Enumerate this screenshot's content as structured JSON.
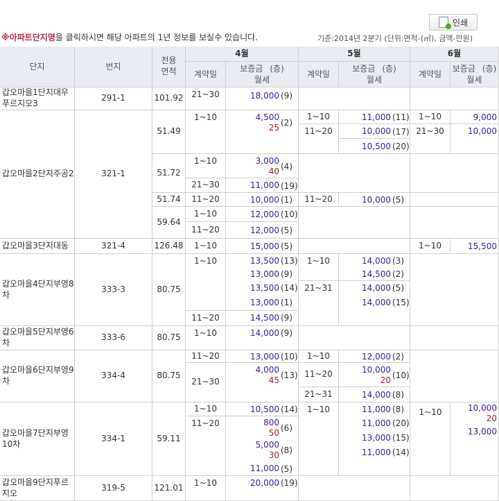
{
  "toolbar": {
    "print_label": "인쇄"
  },
  "notice": {
    "highlight": "※아파트단지명",
    "rest": "을 클릭하시면 해당 아파트의 1년 정보를 보실수 있습니다."
  },
  "basis": "기준:2014년 2분기    (단위:면적-(㎡), 금액-만원)",
  "headers": {
    "complex": "단지",
    "lot": "번지",
    "area_1": "전용",
    "area_2": "면적",
    "months": [
      "4월",
      "5월",
      "6월"
    ],
    "contract": "계약일",
    "deposit": "보증금",
    "rent": "월세",
    "floor": "(층)"
  },
  "rows": [
    {
      "name": "갑오마을1단지대우푸르지오3",
      "lot": "291-1",
      "area": "101.92",
      "m4_date": "21~30",
      "m4_dep": "18,000",
      "m4_floor": "(9)"
    },
    {
      "name": "갑오마을2단지주공2",
      "lot": "321-1"
    },
    {
      "name": "갑오마을3단지대동",
      "lot": "321-4",
      "area": "126.48",
      "m4_date": "1~10",
      "m4_dep": "15,000",
      "m4_floor": "(5)",
      "m6_date": "1~10",
      "m6_dep": "15,500"
    },
    {
      "name": "갑오마을4단지부영8차",
      "lot": "333-3",
      "area": "80.75"
    },
    {
      "name": "갑오마을5단지부영6차",
      "lot": "333-6",
      "area": "80.75",
      "m4_date": "1~10",
      "m4_dep": "14,000",
      "m4_floor": "(9)"
    },
    {
      "name": "갑오마을6단지부영9차",
      "lot": "334-4",
      "area": "80.75"
    },
    {
      "name": "갑오마을7단지부영10차",
      "lot": "334-1",
      "area": "59.11"
    },
    {
      "name": "갑오마을9단지푸르지오",
      "lot": "319-5",
      "area": "121.01",
      "m4_date": "1~10",
      "m4_dep": "20,000",
      "m4_floor": "(19)"
    }
  ],
  "r2": {
    "areas": [
      "51.49",
      "51.72",
      "51.74",
      "59.64"
    ],
    "a1_m4_date": "1~10",
    "a1_m4_dep": "4,500",
    "a1_m4_rent": "25",
    "a1_m4_floor": "(2)",
    "a1_m5": [
      {
        "date": "1~10",
        "dep": "11,000",
        "floor": "(11)"
      },
      {
        "date": "11~20",
        "dep": "10,000",
        "floor": "(17)"
      },
      {
        "date": "",
        "dep": "10,500",
        "floor": "(20)"
      }
    ],
    "a1_m6": [
      {
        "date": "1~10",
        "dep": "9,000"
      },
      {
        "date": "21~30",
        "dep": "10,000"
      }
    ],
    "a2_m4": [
      {
        "date": "1~10",
        "dep": "3,000",
        "rent": "40",
        "floor": "(4)"
      },
      {
        "date": "21~30",
        "dep": "11,000",
        "floor": "(19)"
      }
    ],
    "a3_m4": {
      "date": "11~20",
      "dep": "10,000",
      "floor": "(1)"
    },
    "a3_m5": {
      "date": "11~20",
      "dep": "10,000",
      "floor": "(5)"
    },
    "a4_m4": [
      {
        "date": "1~10",
        "dep": "12,000",
        "floor": "(10)"
      },
      {
        "date": "11~20",
        "dep": "12,000",
        "floor": "(5)"
      }
    ]
  },
  "r4": {
    "m4_dates": [
      "1~10",
      "11~20"
    ],
    "m4": [
      {
        "dep": "13,500",
        "floor": "(13)"
      },
      {
        "dep": "13,000",
        "floor": "(9)"
      },
      {
        "dep": "13,500",
        "floor": "(14)"
      },
      {
        "dep": "13,000",
        "floor": "(1)"
      },
      {
        "dep": "14,500",
        "floor": "(9)"
      }
    ],
    "m5_dates": [
      "1~10",
      "21~31"
    ],
    "m5": [
      {
        "dep": "14,000",
        "floor": "(3)"
      },
      {
        "dep": "14,500",
        "floor": "(2)"
      },
      {
        "dep": "14,000",
        "floor": "(5)"
      },
      {
        "dep": "14,000",
        "floor": "(15)"
      }
    ]
  },
  "r6": {
    "m4": [
      {
        "date": "11~20",
        "dep": "13,000",
        "floor": "(10)"
      },
      {
        "date": "21~30",
        "dep": "4,000",
        "rent": "45",
        "floor": "(13)"
      }
    ],
    "m5": [
      {
        "date": "1~10",
        "dep": "12,000",
        "floor": "(2)"
      },
      {
        "date": "11~20",
        "dep": "10,000",
        "rent": "20",
        "floor": "(10)"
      },
      {
        "date": "21~31",
        "dep": "14,000",
        "floor": "(8)"
      }
    ]
  },
  "r7": {
    "m4_dates": [
      "1~10",
      "11~20"
    ],
    "m4": [
      {
        "dep": "10,500",
        "floor": "(14)"
      },
      {
        "dep": "800",
        "rent": "50",
        "floor": "(6)"
      },
      {
        "dep": "5,000",
        "rent": "30",
        "floor": "(8)"
      },
      {
        "dep": "11,000",
        "floor": "(5)"
      }
    ],
    "m5_date": "1~10",
    "m5": [
      {
        "dep": "11,000",
        "floor": "(8)"
      },
      {
        "dep": "11,000",
        "floor": "(20)"
      },
      {
        "dep": "13,000",
        "floor": "(15)"
      },
      {
        "dep": "11,000",
        "floor": "(14)"
      }
    ],
    "m6_date": "1~10",
    "m6": {
      "dep": "10,000",
      "rent": "20",
      "dep2": "13,000"
    }
  },
  "colors": {
    "header_bg": "#e9edf3",
    "deposit": "#3b1b9c",
    "rent": "#9a1c1c",
    "notice": "#c0264c",
    "border": "#cfcfcf"
  }
}
